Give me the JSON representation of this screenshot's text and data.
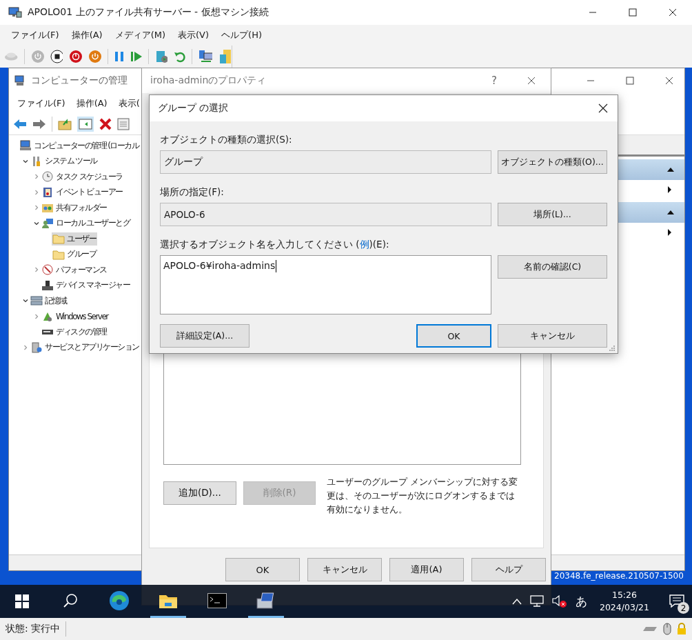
{
  "vm_window": {
    "title": "APOLO01 上のファイル共有サーバー - 仮想マシン接続",
    "menu": [
      "ファイル(F)",
      "操作(A)",
      "メディア(M)",
      "表示(V)",
      "ヘルプ(H)"
    ]
  },
  "computer_management": {
    "title": "コンピューターの管理",
    "menu": [
      "ファイル(F)",
      "操作(A)",
      "表示("
    ],
    "tree": [
      {
        "label": "コンピューターの管理 (ローカル",
        "selected": false,
        "children": [
          {
            "label": "システム ツール",
            "expanded": true,
            "selected": false,
            "children": [
              {
                "label": "タスク スケジューラ",
                "expanded": false,
                "selected": false
              },
              {
                "label": "イベント ビューアー",
                "expanded": false,
                "selected": false
              },
              {
                "label": "共有フォルダー",
                "expanded": false,
                "selected": false
              },
              {
                "label": "ローカル ユーザーとグ",
                "expanded": true,
                "selected": false,
                "children": [
                  {
                    "label": "ユーザー",
                    "selected": true
                  },
                  {
                    "label": "グループ",
                    "selected": false
                  }
                ]
              },
              {
                "label": "パフォーマンス",
                "expanded": false,
                "selected": false
              },
              {
                "label": "デバイス マネージャー",
                "selected": false
              }
            ]
          },
          {
            "label": "記憶域",
            "expanded": true,
            "selected": false,
            "children": [
              {
                "label": "Windows Server",
                "expanded": false,
                "selected": false
              },
              {
                "label": "ディスクの管理",
                "selected": false
              }
            ]
          },
          {
            "label": "サービスとアプリケーション",
            "expanded": false,
            "selected": false
          }
        ]
      }
    ]
  },
  "properties_dialog": {
    "title": "iroha-adminのプロパティ",
    "help": "?",
    "buttons": [
      {
        "label": "追加(D)...",
        "disabled": false
      },
      {
        "label": "削除(R)",
        "disabled": true
      }
    ],
    "note": "ユーザーのグループ メンバーシップに対する変更は、そのユーザーが次にログオンするまでは有効になりません。",
    "footer_buttons": [
      "OK",
      "キャンセル",
      "適用(A)",
      "ヘルプ"
    ]
  },
  "group_dialog": {
    "title": "グループ の選択",
    "object_type_label": "オブジェクトの種類の選択(S):",
    "object_type_value": "グループ",
    "object_type_button": "オブジェクトの種類(O)...",
    "location_label": "場所の指定(F):",
    "location_value": "APOLO-6",
    "location_button": "場所(L)...",
    "name_label_before": "選択するオブジェクト名を入力してください (",
    "name_label_link": "例",
    "name_label_after": ")(E):",
    "name_value": "APOLO-6¥iroha-admins",
    "check_button": "名前の確認(C)",
    "advanced_button": "詳細設定(A)...",
    "ok_button": "OK",
    "cancel_button": "キャンセル"
  },
  "desktop_text": "20348.fe_release.210507-1500",
  "taskbar": {
    "apps": [
      {
        "running": false
      },
      {
        "running": false
      },
      {
        "running": true
      },
      {
        "running": false
      },
      {
        "running": true
      }
    ],
    "ime": "あ",
    "time": "15:26",
    "date": "2024/03/21",
    "notifications": "2"
  },
  "status": "状態: 実行中"
}
